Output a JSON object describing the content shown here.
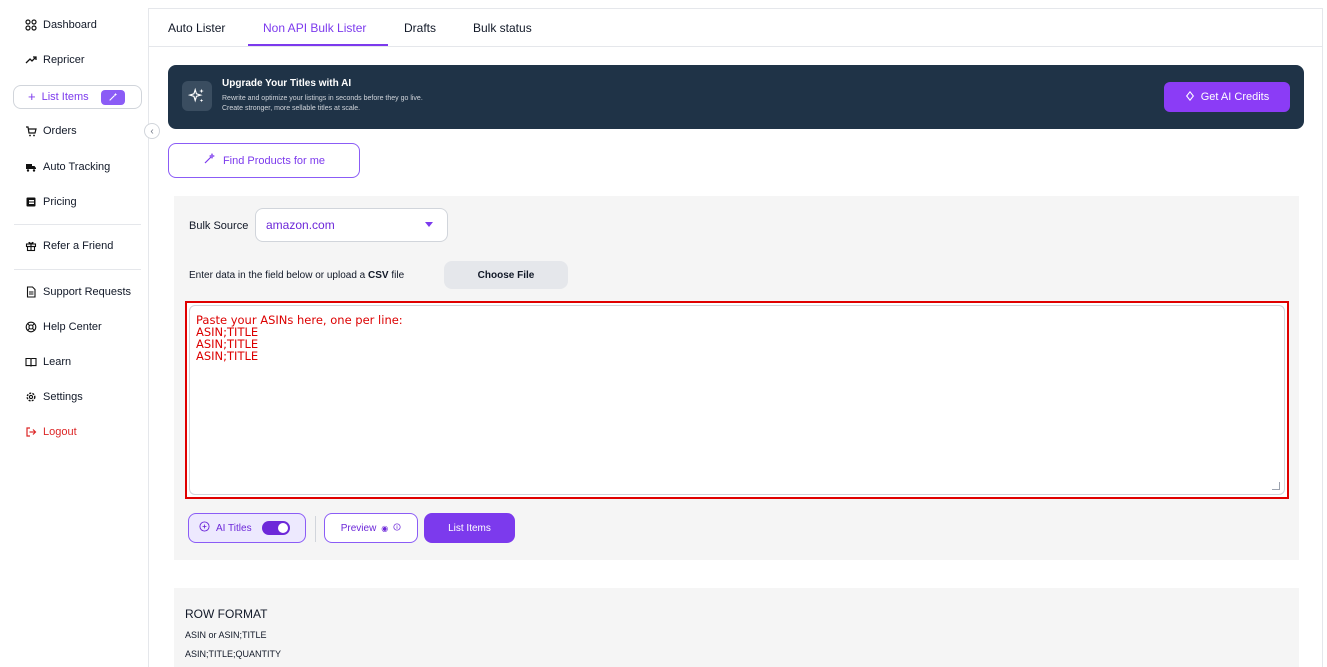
{
  "sidebar": {
    "items": [
      {
        "label": "Dashboard",
        "icon": "dashboard-grid-icon"
      },
      {
        "label": "Repricer",
        "icon": "trend-line-icon"
      },
      {
        "label": "List Items",
        "icon": "plus-icon"
      },
      {
        "label": "Orders",
        "icon": "cart-icon"
      },
      {
        "label": "Auto Tracking",
        "icon": "truck-icon"
      },
      {
        "label": "Pricing",
        "icon": "pricing-card-icon"
      },
      {
        "label": "Refer a Friend",
        "icon": "gift-icon"
      },
      {
        "label": "Support Requests",
        "icon": "document-icon"
      },
      {
        "label": "Help Center",
        "icon": "lifebuoy-icon"
      },
      {
        "label": "Learn",
        "icon": "book-icon"
      },
      {
        "label": "Settings",
        "icon": "gear-icon"
      },
      {
        "label": "Logout",
        "icon": "logout-icon"
      }
    ]
  },
  "tabs": [
    "Auto Lister",
    "Non API Bulk Lister",
    "Drafts",
    "Bulk status"
  ],
  "active_tab": "Non API Bulk Lister",
  "banner": {
    "title": "Upgrade Your Titles with AI",
    "line1": "Rewrite and optimize your listings in seconds before they go live.",
    "line2": "Create stronger, more sellable titles at scale.",
    "button": "Get AI Credits"
  },
  "find_products_button": "Find Products for me",
  "bulk": {
    "source_label": "Bulk Source",
    "source_value": "amazon.com",
    "upload_prefix": "Enter data in the field below or upload a",
    "upload_bold": "CSV",
    "upload_suffix": "file",
    "choose_file": "Choose File"
  },
  "textarea": {
    "lines": [
      "Paste your ASINs here, one per line:",
      "ASIN;TITLE",
      "ASIN;TITLE",
      "ASIN;TITLE"
    ]
  },
  "actions": {
    "ai_titles": "AI Titles",
    "preview": "Preview",
    "list_items": "List Items"
  },
  "row_format": {
    "title": "ROW FORMAT",
    "line1": "ASIN or ASIN;TITLE",
    "line2": "ASIN;TITLE;QUANTITY"
  },
  "colors": {
    "accent": "#7c3aed",
    "banner_bg": "#1f3347",
    "highlight_border": "#e00000",
    "logout": "#dc2626"
  }
}
